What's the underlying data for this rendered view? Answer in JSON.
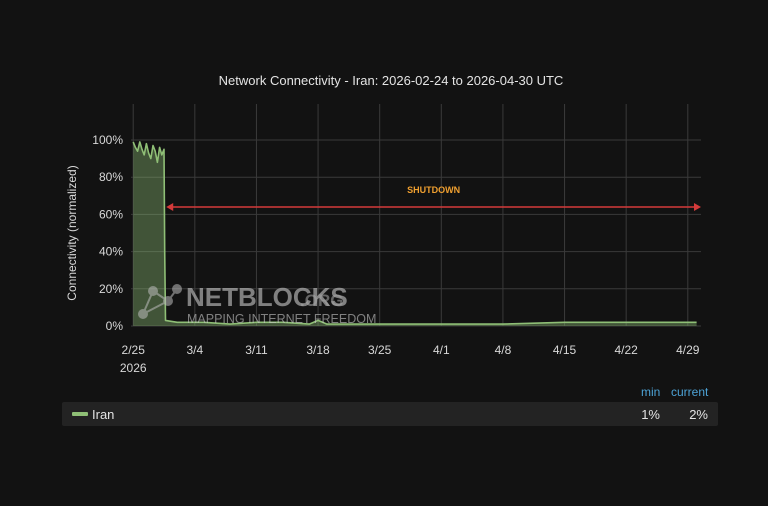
{
  "chart_data": {
    "type": "area",
    "title": "Network Connectivity - Iran: 2026-02-24 to 2026-04-30 UTC",
    "xlabel": "",
    "ylabel": "Connectivity (normalized)",
    "y_ticks": [
      "0%",
      "20%",
      "40%",
      "60%",
      "80%",
      "100%"
    ],
    "ylim": [
      0,
      100
    ],
    "x_ticks": [
      {
        "date": "2026-02-25",
        "label": "2/25",
        "sublabel": "2026"
      },
      {
        "date": "2026-03-04",
        "label": "3/4"
      },
      {
        "date": "2026-03-11",
        "label": "3/11"
      },
      {
        "date": "2026-03-18",
        "label": "3/18"
      },
      {
        "date": "2026-03-25",
        "label": "3/25"
      },
      {
        "date": "2026-04-01",
        "label": "4/1"
      },
      {
        "date": "2026-04-08",
        "label": "4/8"
      },
      {
        "date": "2026-04-15",
        "label": "4/15"
      },
      {
        "date": "2026-04-22",
        "label": "4/22"
      },
      {
        "date": "2026-04-29",
        "label": "4/29"
      }
    ],
    "xlim": [
      "2026-02-24T18:00",
      "2026-04-30T12:00"
    ],
    "grid": true,
    "series": [
      {
        "name": "Iran",
        "color": "#8fbf76",
        "points": [
          [
            "2026-02-25T00:00",
            99
          ],
          [
            "2026-02-25T06:00",
            96
          ],
          [
            "2026-02-25T12:00",
            94
          ],
          [
            "2026-02-25T18:00",
            99
          ],
          [
            "2026-02-26T00:00",
            95
          ],
          [
            "2026-02-26T06:00",
            92
          ],
          [
            "2026-02-26T12:00",
            98
          ],
          [
            "2026-02-26T18:00",
            93
          ],
          [
            "2026-02-27T00:00",
            90
          ],
          [
            "2026-02-27T06:00",
            97
          ],
          [
            "2026-02-27T12:00",
            94
          ],
          [
            "2026-02-27T18:00",
            88
          ],
          [
            "2026-02-28T00:00",
            96
          ],
          [
            "2026-02-28T06:00",
            92
          ],
          [
            "2026-02-28T12:00",
            95
          ],
          [
            "2026-02-28T14:00",
            40
          ],
          [
            "2026-02-28T16:00",
            3
          ],
          [
            "2026-03-02T00:00",
            2
          ],
          [
            "2026-03-05T00:00",
            2
          ],
          [
            "2026-03-08T00:00",
            1
          ],
          [
            "2026-03-11T00:00",
            2
          ],
          [
            "2026-03-14T00:00",
            2
          ],
          [
            "2026-03-17T00:00",
            1
          ],
          [
            "2026-03-18T00:00",
            3
          ],
          [
            "2026-03-19T00:00",
            1
          ],
          [
            "2026-03-25T00:00",
            1
          ],
          [
            "2026-04-01T00:00",
            1
          ],
          [
            "2026-04-08T00:00",
            1
          ],
          [
            "2026-04-15T00:00",
            2
          ],
          [
            "2026-04-22T00:00",
            2
          ],
          [
            "2026-04-30T00:00",
            2
          ]
        ]
      }
    ],
    "annotation": {
      "label": "SHUTDOWN",
      "from": "2026-02-28T18:00",
      "to": "2026-04-30T12:00",
      "y": 64,
      "label_color": "#f0a030",
      "arrow_color": "#d43a3a"
    },
    "watermark": {
      "brand": "NETBLOCKS",
      "suffix": ".ORG",
      "tagline": "MAPPING INTERNET FREEDOM"
    },
    "legend": {
      "columns": [
        "min",
        "current"
      ],
      "rows": [
        {
          "name": "Iran",
          "color": "#8fbf76",
          "min": "1%",
          "current": "2%"
        }
      ]
    },
    "colors": {
      "background": "#121212",
      "grid": "#3a3a3a",
      "axis_text": "#d8d8d8",
      "legend_header": "#4da3d6"
    }
  }
}
